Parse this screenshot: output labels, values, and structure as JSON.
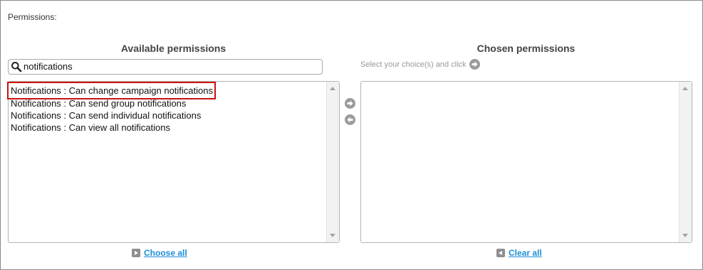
{
  "permissions_label": "Permissions:",
  "available": {
    "title": "Available permissions",
    "search": {
      "value": "notifications",
      "icon": "search-icon"
    },
    "options": [
      {
        "label": "Notifications : Can change campaign notifications",
        "highlighted": true
      },
      {
        "label": "Notifications : Can send group notifications",
        "highlighted": false
      },
      {
        "label": "Notifications : Can send individual notifications",
        "highlighted": false
      },
      {
        "label": "Notifications : Can view all notifications",
        "highlighted": false
      }
    ],
    "choose_all_label": "Choose all"
  },
  "chosen": {
    "title": "Chosen permissions",
    "help_text": "Select your choice(s) and click",
    "options": [],
    "clear_all_label": "Clear all"
  },
  "colors": {
    "highlight_border": "#cc1111",
    "link": "#1a8fd6",
    "icon_gray": "#9b9b9b"
  }
}
